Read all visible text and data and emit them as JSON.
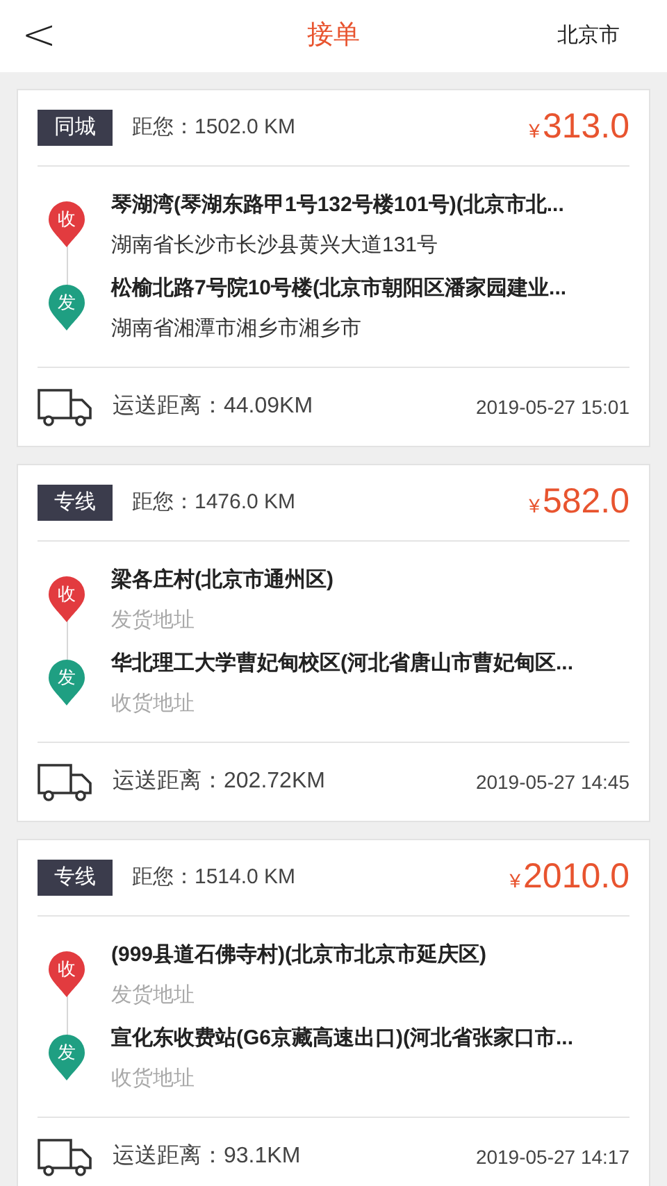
{
  "header": {
    "back": "<",
    "title": "接单",
    "city": "北京市"
  },
  "orders": [
    {
      "tag": "同城",
      "distance": "距您：1502.0 KM",
      "currency": "¥",
      "price": "313.0",
      "stops": [
        {
          "kind": "pickup",
          "pin": "收",
          "name": "琴湖湾(琴湖东路甲1号132号楼101号)(北京市北...",
          "detail": "湖南省长沙市长沙县黄兴大道131号",
          "muted": false
        },
        {
          "kind": "delivery",
          "pin": "发",
          "name": "松榆北路7号院10号楼(北京市朝阳区潘家园建业...",
          "detail": "湖南省湘潭市湘乡市湘乡市",
          "muted": false
        }
      ],
      "route_distance": "运送距离：44.09KM",
      "time": "2019-05-27 15:01"
    },
    {
      "tag": "专线",
      "distance": "距您：1476.0 KM",
      "currency": "¥",
      "price": "582.0",
      "stops": [
        {
          "kind": "pickup",
          "pin": "收",
          "name": "梁各庄村(北京市通州区)",
          "detail": "发货地址",
          "muted": true
        },
        {
          "kind": "delivery",
          "pin": "发",
          "name": "华北理工大学曹妃甸校区(河北省唐山市曹妃甸区...",
          "detail": "收货地址",
          "muted": true
        }
      ],
      "route_distance": "运送距离：202.72KM",
      "time": "2019-05-27 14:45"
    },
    {
      "tag": "专线",
      "distance": "距您：1514.0 KM",
      "currency": "¥",
      "price": "2010.0",
      "stops": [
        {
          "kind": "pickup",
          "pin": "收",
          "name": "(999县道石佛寺村)(北京市北京市延庆区)",
          "detail": "发货地址",
          "muted": true
        },
        {
          "kind": "delivery",
          "pin": "发",
          "name": "宣化东收费站(G6京藏高速出口)(河北省张家口市...",
          "detail": "收货地址",
          "muted": true
        }
      ],
      "route_distance": "运送距离：93.1KM",
      "time": "2019-05-27 14:17"
    }
  ]
}
